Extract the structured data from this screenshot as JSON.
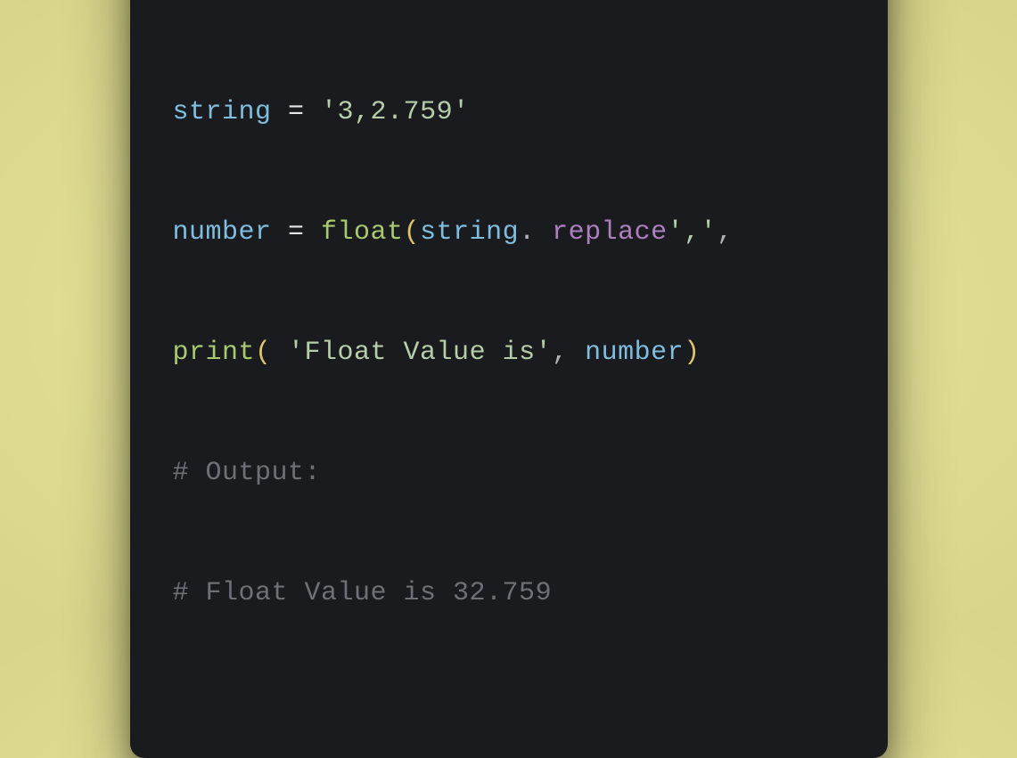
{
  "traffic_lights": {
    "red": "#ff5f56",
    "yellow": "#ffbd2e",
    "green": "#27c93f"
  },
  "code": {
    "l1": {
      "t1": "string",
      "t2": " = ",
      "t3": "'3,2.759'"
    },
    "l2": {
      "t1": "number",
      "t2": " = ",
      "t3": "float",
      "t4": "(",
      "t5": "string",
      "t6": ".",
      "t7": " replace",
      "t8": "','",
      "t9": ","
    },
    "l3": {
      "t1": "print",
      "t2": "( ",
      "t3": "'Float Value is'",
      "t4": ", ",
      "t5": "number",
      "t6": ")"
    },
    "l4": {
      "t1": "# Output:"
    },
    "l5": {
      "t1": "# Float Value is 32.759"
    }
  }
}
